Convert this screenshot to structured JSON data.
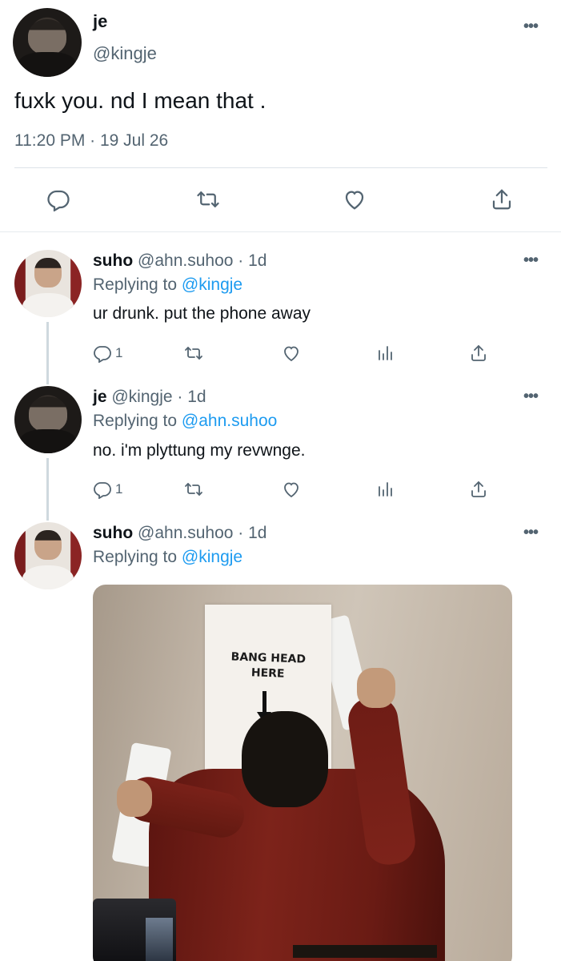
{
  "main_tweet": {
    "name": "je",
    "handle": "@kingje",
    "text": "fuxk you. nd I mean that .",
    "timestamp": "11:20 PM · 19 Jul 26",
    "more_label": "•••"
  },
  "replies": [
    {
      "name": "suho",
      "meta": "@ahn.suhoo · 1d",
      "replying_prefix": "Replying to ",
      "replying_to": "@kingje",
      "text": "ur drunk. put the phone away",
      "reply_count": "1",
      "more_label": "•••"
    },
    {
      "name": "je",
      "meta": "@kingje · 1d",
      "replying_prefix": "Replying to ",
      "replying_to": "@ahn.suhoo",
      "text": "no. i'm plyttung my revwnge.",
      "reply_count": "1",
      "more_label": "•••"
    },
    {
      "name": "suho",
      "meta": "@ahn.suhoo · 1d",
      "replying_prefix": "Replying to ",
      "replying_to": "@kingje",
      "more_label": "•••",
      "media": {
        "sign_line1": "BANG HEAD",
        "sign_line2": "HERE"
      }
    }
  ],
  "colors": {
    "link": "#1d9bf0",
    "secondary_text": "#536471",
    "divider": "#dde3e8"
  }
}
